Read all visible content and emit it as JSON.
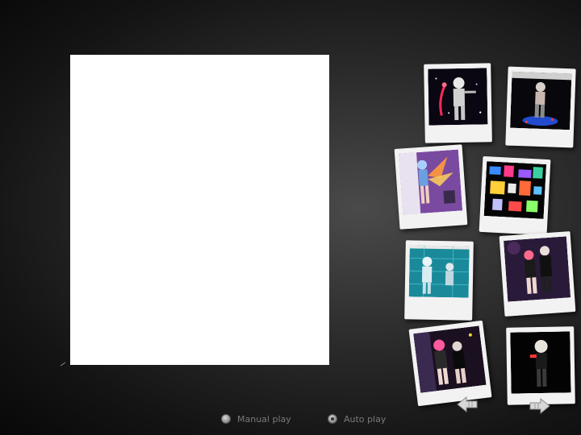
{
  "playback": {
    "manual_label": "Manual play",
    "auto_label": "Auto play",
    "selected_mode": "auto"
  },
  "gallery": {
    "thumbnail_count": 8,
    "thumbnails": [
      {
        "name": "thumbnail-1",
        "scene": "white-haired character with red sword on dark starry background"
      },
      {
        "name": "thumbnail-2",
        "scene": "character standing on glowing blue platform"
      },
      {
        "name": "thumbnail-3",
        "scene": "character with glowing orange wings on purple background"
      },
      {
        "name": "thumbnail-4",
        "scene": "collage of colorful characters on black background"
      },
      {
        "name": "thumbnail-5",
        "scene": "characters on teal patterned background"
      },
      {
        "name": "thumbnail-6",
        "scene": "pair in black outfits on dark purple background"
      },
      {
        "name": "thumbnail-7",
        "scene": "pink-haired pair in dark outfits"
      },
      {
        "name": "thumbnail-8",
        "scene": "blonde character in black outfit on black background"
      }
    ]
  },
  "icons": {
    "prev": "arrow-left-icon",
    "next": "arrow-right-icon"
  },
  "colors": {
    "background": "#141414",
    "frame": "#f2f2f2",
    "main_photo": "#ffffff",
    "label_text": "#7a7a7a"
  }
}
